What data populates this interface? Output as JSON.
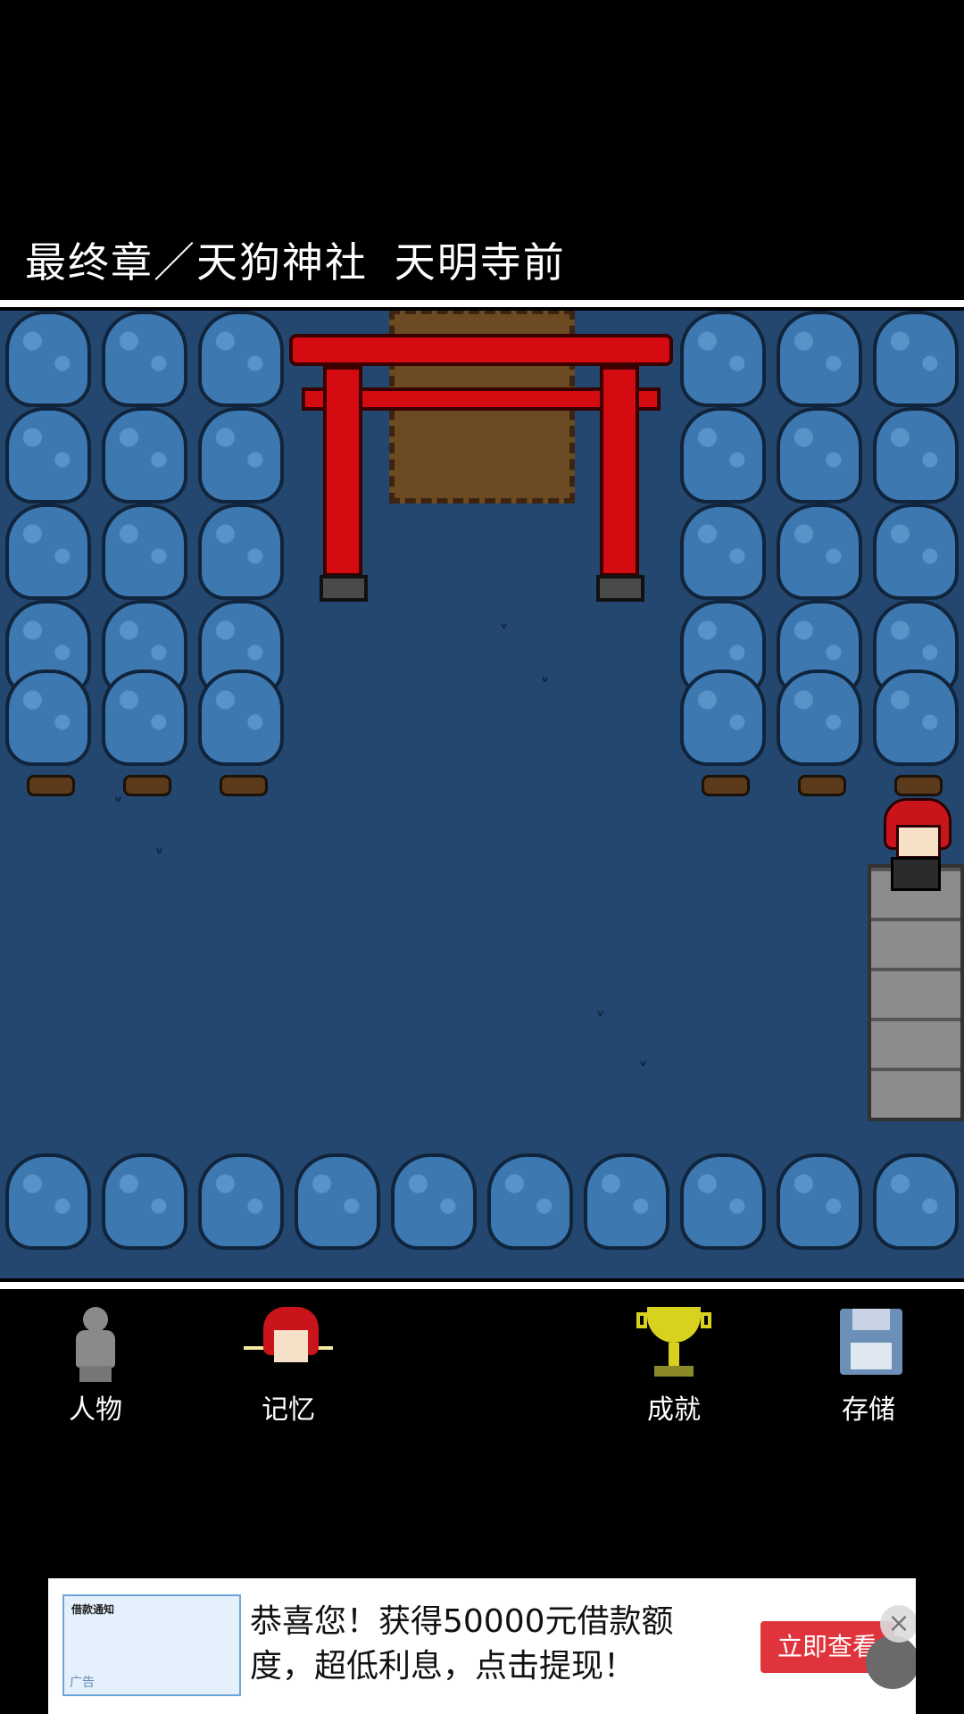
{
  "location": {
    "title": "最终章／天狗神社 天明寺前"
  },
  "menu": {
    "person_label": "人物",
    "memory_label": "记忆",
    "achievement_label": "成就",
    "save_label": "存储"
  },
  "ad": {
    "thumb_title": "借款通知",
    "thumb_tag": "广告",
    "text": "恭喜您！获得50000元借款额度，超低利息，点击提现！",
    "button_label": "立即查看",
    "close_symbol": "×"
  },
  "colors": {
    "scene_bg": "#23476f",
    "torii_red": "#d40c12",
    "tree_blue": "#3e78b0"
  }
}
